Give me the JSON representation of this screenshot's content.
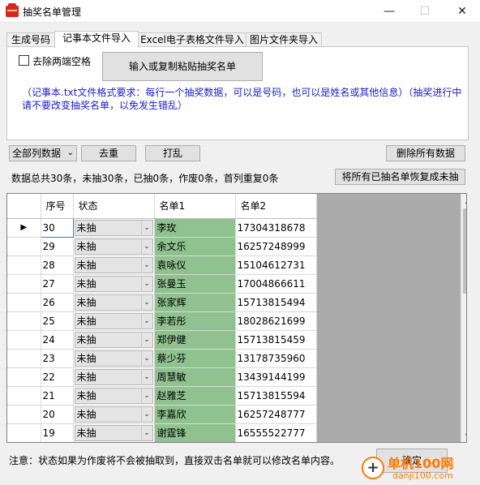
{
  "window": {
    "title": "抽奖名单管理",
    "minimize": "—",
    "maximize": "☐",
    "close": "✕"
  },
  "tabs": [
    {
      "label": "生成号码",
      "active": false
    },
    {
      "label": "记事本文件导入",
      "active": true
    },
    {
      "label": "Excel电子表格文件导入",
      "active": false
    },
    {
      "label": "图片文件夹导入",
      "active": false
    }
  ],
  "panel": {
    "trim_label": "去除两端空格",
    "import_button": "输入或复制粘贴抽奖名单",
    "note": "（记事本.txt文件格式要求：每行一个抽奖数据，可以是号码，也可以是姓名或其他信息）（抽奖进行中请不要改变抽奖名单，以免发生错乱）"
  },
  "toolbar": {
    "filter_value": "全部列数据",
    "dedupe": "去重",
    "shuffle": "打乱",
    "delete_all": "删除所有数据",
    "restore_all": "将所有已抽名单恢复成未抽"
  },
  "stats": "数据总共30条，未抽30条，已抽0条，作废0条，首列重复0条",
  "grid": {
    "headers": [
      "",
      "序号",
      "状态",
      "名单1",
      "名单2"
    ],
    "current_marker": "▶",
    "rows": [
      {
        "seq": "30",
        "status": "未抽",
        "name1": "李玫",
        "name2": "17304318678"
      },
      {
        "seq": "29",
        "status": "未抽",
        "name1": "余文乐",
        "name2": "16257248999"
      },
      {
        "seq": "28",
        "status": "未抽",
        "name1": "袁咏仪",
        "name2": "15104612731"
      },
      {
        "seq": "27",
        "status": "未抽",
        "name1": "张曼玉",
        "name2": "17004866611"
      },
      {
        "seq": "26",
        "status": "未抽",
        "name1": "张家辉",
        "name2": "15713815494"
      },
      {
        "seq": "25",
        "status": "未抽",
        "name1": "李若彤",
        "name2": "18028621699"
      },
      {
        "seq": "24",
        "status": "未抽",
        "name1": "郑伊健",
        "name2": "15713815459"
      },
      {
        "seq": "23",
        "status": "未抽",
        "name1": "蔡少芬",
        "name2": "13178735960"
      },
      {
        "seq": "22",
        "status": "未抽",
        "name1": "周慧敏",
        "name2": "13439144199"
      },
      {
        "seq": "21",
        "status": "未抽",
        "name1": "赵雅芝",
        "name2": "15713815594"
      },
      {
        "seq": "20",
        "status": "未抽",
        "name1": "李嘉欣",
        "name2": "16257248777"
      },
      {
        "seq": "19",
        "status": "未抽",
        "name1": "谢霆锋",
        "name2": "16555522777"
      }
    ]
  },
  "footer": {
    "note": "注意：状态如果为作废将不会被抽取到，直接双击名单就可以修改名单内容。",
    "ok": "确定"
  },
  "watermark": {
    "symbol": "+",
    "text": "单机100网",
    "domain": "danji100.com"
  },
  "colors": {
    "name1_bg": "#8fc28f",
    "note_text": "#1a1ad6",
    "watermark": "#ff7a00"
  }
}
